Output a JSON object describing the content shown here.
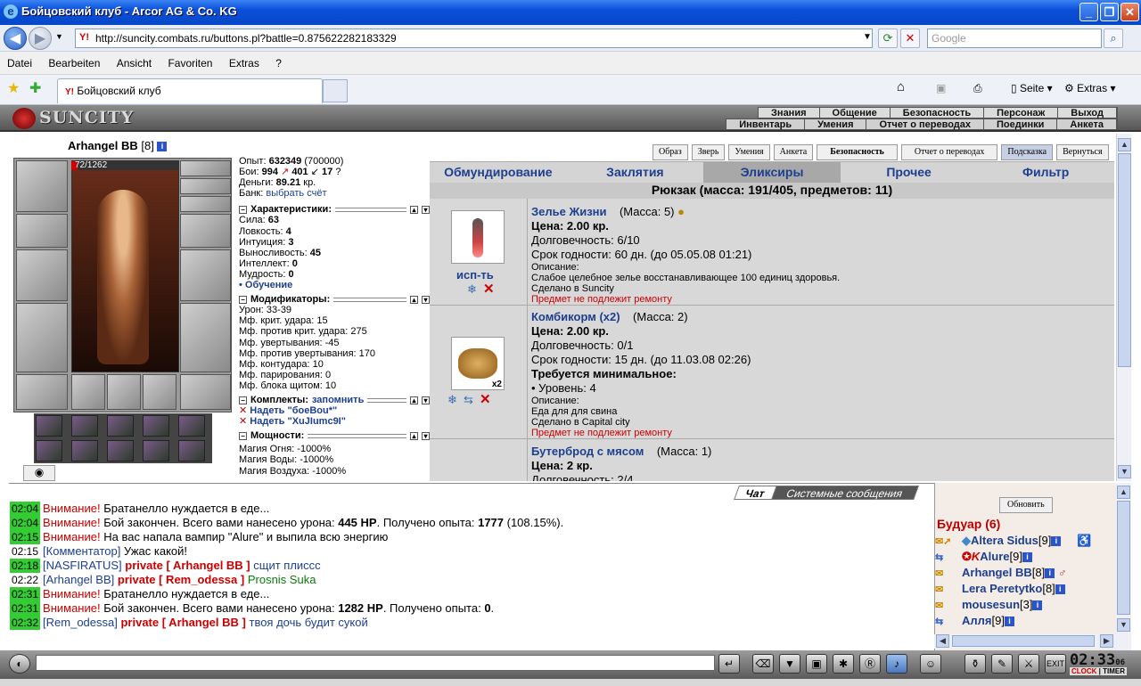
{
  "window": {
    "title": "Бойцовский клуб - Arcor AG & Co. KG"
  },
  "address": {
    "url": "http://suncity.combats.ru/buttons.pl?battle=0.875622282183329",
    "search_placeholder": "Google"
  },
  "menu": {
    "items": [
      "Datei",
      "Bearbeiten",
      "Ansicht",
      "Favoriten",
      "Extras",
      "?"
    ]
  },
  "tab": {
    "title": "Бойцовский клуб"
  },
  "toolbar": {
    "page_label": "Seite",
    "extras_label": "Extras"
  },
  "game": {
    "logo": "SUNCITY",
    "nav_top": [
      "Знания",
      "Общение",
      "Безопасность",
      "Персонаж",
      "Выход"
    ],
    "nav_sub": [
      "Инвентарь",
      "Умения",
      "Отчет о переводах",
      "Поединки",
      "Анкета"
    ],
    "char": {
      "name": "Arhangel BB",
      "level": "[8]",
      "hp": "72/1262",
      "hp_fraction": 0.057,
      "exp_label": "Опыт:",
      "exp": "632349",
      "exp_next": "(700000)",
      "fights_label": "Бои:",
      "wins": "994",
      "losses": "401",
      "draws": "17",
      "money_label": "Деньги:",
      "money": "89.21",
      "money_unit": "кр.",
      "bank_label": "Банк:",
      "bank_link": "выбрать счёт"
    },
    "sections": {
      "chars": "Характеристики:",
      "mods": "Модификаторы:",
      "sets": "Комплекты:",
      "sets_link": "запомнить",
      "powers": "Мощности:"
    },
    "stats": [
      {
        "label": "Сила:",
        "value": "63"
      },
      {
        "label": "Ловкость:",
        "value": "4"
      },
      {
        "label": "Интуиция:",
        "value": "3"
      },
      {
        "label": "Выносливость:",
        "value": "45"
      },
      {
        "label": "Интеллект:",
        "value": "0"
      },
      {
        "label": "Мудрость:",
        "value": "0"
      }
    ],
    "training": "• Обучение",
    "mods": [
      "Урон: 33-39",
      "Мф. крит. удара: 15",
      "Мф. против крит. удара: 275",
      "Мф. увертывания: -45",
      "Мф. против увертывания: 170",
      "Мф. контудара: 10",
      "Мф. парирования: 0",
      "Мф. блока щитом: 10"
    ],
    "sets": [
      "Надеть \"боеВоu*\"",
      "Надеть \"XuJIumc9I\""
    ],
    "powers": [
      "Магия Огня: -1000%",
      "Магия Воды: -1000%",
      "Магия Воздуха: -1000%"
    ],
    "buttons": [
      "Образ",
      "Зверь",
      "Умения",
      "Анкета",
      "Безопасность",
      "Отчет о переводах",
      "Подсказка",
      "Вернуться"
    ],
    "tabs": [
      "Обмундирование",
      "Заклятия",
      "Эликсиры",
      "Прочее",
      "Фильтр"
    ],
    "backpack": "Рюкзак (масса: 191/405, предметов: 11)",
    "items": [
      {
        "name": "Зелье Жизни",
        "mass": "(Масса: 5)",
        "price": "Цена: 2.00 кр.",
        "durability": "Долговечность: 6/10",
        "expire": "Срок годности: 60 дн. (до 05.05.08 01:21)",
        "desc_label": "Описание:",
        "desc": "Слабое целебное зелье восстанавливающее 100 единиц здоровья.",
        "made": "Сделано в Suncity",
        "repair": "Предмет не подлежит ремонту",
        "use": "исп-ть"
      },
      {
        "name": "Комбикорм (x2)",
        "mass": "(Масса: 2)",
        "price": "Цена: 2.00 кр.",
        "durability": "Долговечность: 0/1",
        "expire": "Срок годности: 15 дн. (до 11.03.08 02:26)",
        "req": "Требуется минимальное:",
        "req_level": "• Уровень: 4",
        "desc_label": "Описание:",
        "desc": "Еда для для свина",
        "made": "Сделано в Capital city",
        "repair": "Предмет не подлежит ремонту",
        "count": "x2"
      },
      {
        "name": "Бутерброд с мясом",
        "mass": "(Масса: 1)",
        "price": "Цена: 2 кр.",
        "durability": "Долговечность: 2/4"
      }
    ]
  },
  "chat": {
    "tabs": [
      "Чат",
      "Системные сообщения"
    ],
    "messages": [
      {
        "time": "02:04",
        "warn": "Внимание!",
        "text": "Братанелло нуждается в еде..."
      },
      {
        "time": "02:04",
        "warn": "Внимание!",
        "text": "Бой закончен. Всего вами нанесено урона: ",
        "b1": "445 HP",
        "t2": ". Получено опыта: ",
        "b2": "1777",
        "t3": " (108.15%)."
      },
      {
        "time": "02:15",
        "warn": "Внимание!",
        "text": "На вас напала вампир \"Alure\" и выпила всю энергию"
      },
      {
        "time": "02:15",
        "who": "[Комментатор]",
        "text": "Ужас какой!"
      },
      {
        "time": "02:18",
        "who": "[NASFIRATUS]",
        "priv": "private [ Arhangel BB ]",
        "text": "сщит плиссс"
      },
      {
        "time": "02:22",
        "who": "[Arhangel BB]",
        "priv": "private [ Rem_odessa ]",
        "text": "Prosnis Suka"
      },
      {
        "time": "02:31",
        "warn": "Внимание!",
        "text": "Братанелло нуждается в еде..."
      },
      {
        "time": "02:31",
        "warn": "Внимание!",
        "text": "Бой закончен. Всего вами нанесено урона: ",
        "b1": "1282 HP",
        "t2": ". Получено опыта: ",
        "b2": "0",
        "t3": "."
      },
      {
        "time": "02:32",
        "who": "[Rem_odessa]",
        "priv": "private [ Arhangel BB ]",
        "text": "твоя дочь будит сукой"
      }
    ]
  },
  "users": {
    "refresh": "Обновить",
    "room": "Будуар (6)",
    "list": [
      {
        "name": "Altera Sidus",
        "level": "[9]"
      },
      {
        "name": "Alure",
        "level": "[9]"
      },
      {
        "name": "Arhangel BB",
        "level": "[8]"
      },
      {
        "name": "Lera Peretytko",
        "level": "[8]"
      },
      {
        "name": "mousesun",
        "level": "[3]"
      },
      {
        "name": "Алля",
        "level": "[9]"
      }
    ]
  },
  "clock": {
    "time": "02:33",
    "sec": "06",
    "label1": "CLOCK",
    "label2": "TIMER"
  }
}
